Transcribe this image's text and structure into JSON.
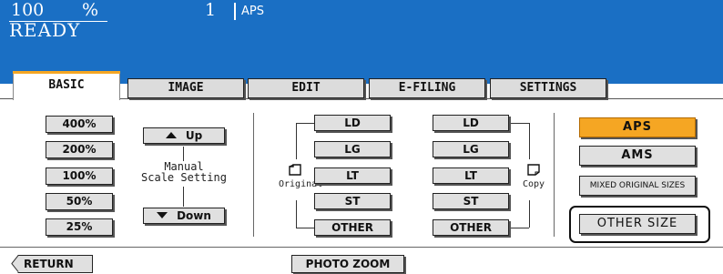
{
  "header": {
    "zoom_value": "100",
    "zoom_unit": "%",
    "copies": "1",
    "paper_mode": "APS",
    "status": "READY",
    "background_color": "#1a6fc4"
  },
  "tabs": [
    {
      "label": "BASIC",
      "active": true
    },
    {
      "label": "IMAGE",
      "active": false
    },
    {
      "label": "EDIT",
      "active": false
    },
    {
      "label": "E-FILING",
      "active": false
    },
    {
      "label": "SETTINGS",
      "active": false
    }
  ],
  "zoom_presets": [
    "400%",
    "200%",
    "100%",
    "50%",
    "25%"
  ],
  "manual_scale": {
    "up_label": "Up",
    "down_label": "Down",
    "label_line1": "Manual",
    "label_line2": "Scale Setting"
  },
  "original": {
    "label": "Original",
    "sizes": [
      "LD",
      "LG",
      "LT",
      "ST",
      "OTHER"
    ]
  },
  "copy": {
    "label": "Copy",
    "sizes": [
      "LD",
      "LG",
      "LT",
      "ST",
      "OTHER"
    ]
  },
  "paper_select": {
    "aps": "APS",
    "ams": "AMS",
    "mixed": "MIXED ORIGINAL SIZES",
    "other_size": "OTHER SIZE",
    "selected": "APS",
    "selected_color": "#f5a623"
  },
  "bottom": {
    "return_label": "RETURN",
    "photo_zoom_label": "PHOTO ZOOM"
  }
}
